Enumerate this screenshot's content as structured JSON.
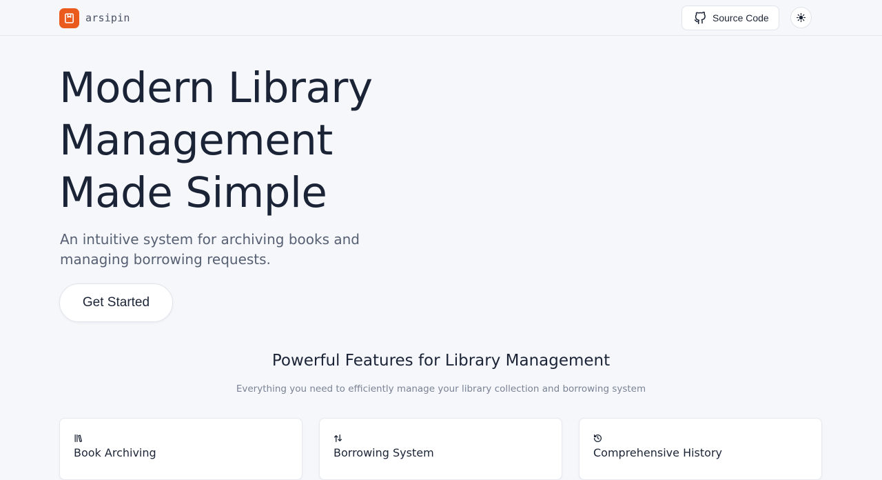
{
  "header": {
    "logo_icon": "bookmark-book-icon",
    "brand": "arsipin",
    "source_code_label": "Source Code",
    "source_icon": "github-icon",
    "theme_icon": "sun-icon",
    "accent_color": "#ea5a1c"
  },
  "hero": {
    "title_line1": "Modern Library",
    "title_line2": "Management",
    "title_line3": "Made Simple",
    "subtitle": "An intuitive system for archiving books and managing borrowing requests.",
    "cta_label": "Get Started"
  },
  "features": {
    "title": "Powerful Features for Library Management",
    "subtitle": "Everything you need to efficiently manage your library collection and borrowing system",
    "cards": [
      {
        "icon": "library-books-icon",
        "title": "Book Archiving"
      },
      {
        "icon": "arrows-swap-icon",
        "title": "Borrowing System"
      },
      {
        "icon": "history-icon",
        "title": "Comprehensive History"
      }
    ]
  }
}
